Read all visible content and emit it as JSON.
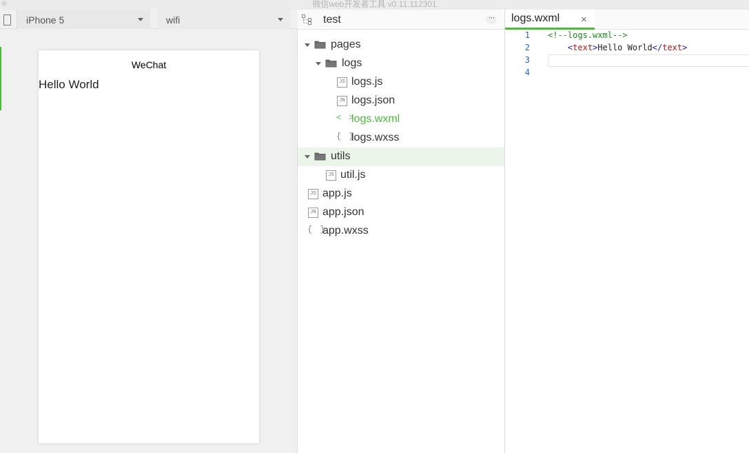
{
  "window": {
    "title": "微信web开发者工具 v0.11.112301"
  },
  "simulator": {
    "device": "iPhone 5",
    "network": "wifi",
    "nav_title": "WeChat",
    "content_text": "Hello World"
  },
  "file_tree": {
    "project": "test",
    "more_label": "···",
    "items": [
      {
        "label": "pages",
        "type": "folder"
      },
      {
        "label": "logs",
        "type": "folder"
      },
      {
        "label": "logs.js",
        "type": "js",
        "icon_text": "JS"
      },
      {
        "label": "logs.json",
        "type": "json",
        "icon_text": "JN"
      },
      {
        "label": "logs.wxml",
        "type": "wxml",
        "icon_text": "< >",
        "active": true
      },
      {
        "label": "logs.wxss",
        "type": "wxss",
        "icon_text": "{ }"
      },
      {
        "label": "utils",
        "type": "folder",
        "selected": true
      },
      {
        "label": "util.js",
        "type": "js",
        "icon_text": "JS"
      },
      {
        "label": "app.js",
        "type": "js",
        "icon_text": "JS"
      },
      {
        "label": "app.json",
        "type": "json",
        "icon_text": "JN"
      },
      {
        "label": "app.wxss",
        "type": "wxss",
        "icon_text": "{ }"
      }
    ]
  },
  "editor": {
    "tab_label": "logs.wxml",
    "close_label": "×",
    "lines": [
      {
        "number": "1",
        "comment": "<!--logs.wxml-->"
      },
      {
        "number": "2",
        "indent": "    ",
        "open_lt": "<",
        "open_tag": "text",
        "open_gt": ">",
        "text": "Hello World",
        "close_lt": "</",
        "close_tag": "text",
        "close_gt": ">"
      },
      {
        "number": "3"
      },
      {
        "number": "4"
      }
    ]
  },
  "colors": {
    "accent": "#4cbb3a",
    "line_number": "#2466b8",
    "comment": "#1a8a1a",
    "tag": "#a61b1b"
  }
}
